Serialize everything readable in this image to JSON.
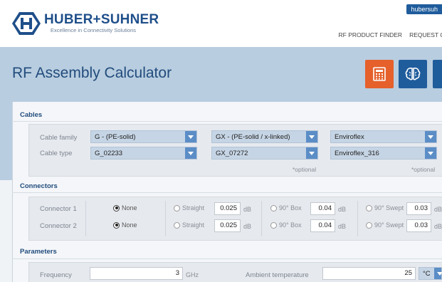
{
  "header": {
    "user_label": "hubersuh",
    "brand_name": "HUBER+SUHNER",
    "tagline": "Excellence in Connectivity Solutions",
    "nav": [
      "RF PRODUCT FINDER",
      "REQUEST Q"
    ]
  },
  "hero": {
    "title": "RF Assembly Calculator",
    "buttons": [
      {
        "icon": "calculator-icon",
        "color": "#e5602b"
      },
      {
        "icon": "brain-icon",
        "color": "#1f5c9c"
      }
    ]
  },
  "cables": {
    "heading": "Cables",
    "family_label": "Cable family",
    "type_label": "Cable type",
    "columns": [
      {
        "family": "G - (PE-solid)",
        "type": "G_02233",
        "optional": ""
      },
      {
        "family": "GX - (PE-solid / x-linked)",
        "type": "GX_07272",
        "optional": "*optional"
      },
      {
        "family": "Enviroflex",
        "type": "Enviroflex_316",
        "optional": "*optional"
      }
    ]
  },
  "connectors": {
    "heading": "Connectors",
    "rows": [
      {
        "label": "Connector 1",
        "none": "None",
        "straight": "Straight",
        "straight_val": "0.025",
        "box": "90° Box",
        "box_val": "0.04",
        "swept": "90° Swept",
        "swept_val": "0.03",
        "selected": "none"
      },
      {
        "label": "Connector 2",
        "none": "None",
        "straight": "Straight",
        "straight_val": "0.025",
        "box": "90° Box",
        "box_val": "0.04",
        "swept": "90° Swept",
        "swept_val": "0.03",
        "selected": "none"
      }
    ],
    "unit": "dB"
  },
  "parameters": {
    "heading": "Parameters",
    "frequency_label": "Frequency",
    "frequency_value": "3",
    "frequency_unit": "GHz",
    "ambient_label": "Ambient temperature",
    "ambient_value": "25",
    "ambient_unit": "°C"
  },
  "colors": {
    "brand_blue": "#1f5c9c",
    "accent_orange": "#e5602b",
    "hero_bg": "#b8cde0",
    "select_arrow": "#5b8dc6"
  }
}
